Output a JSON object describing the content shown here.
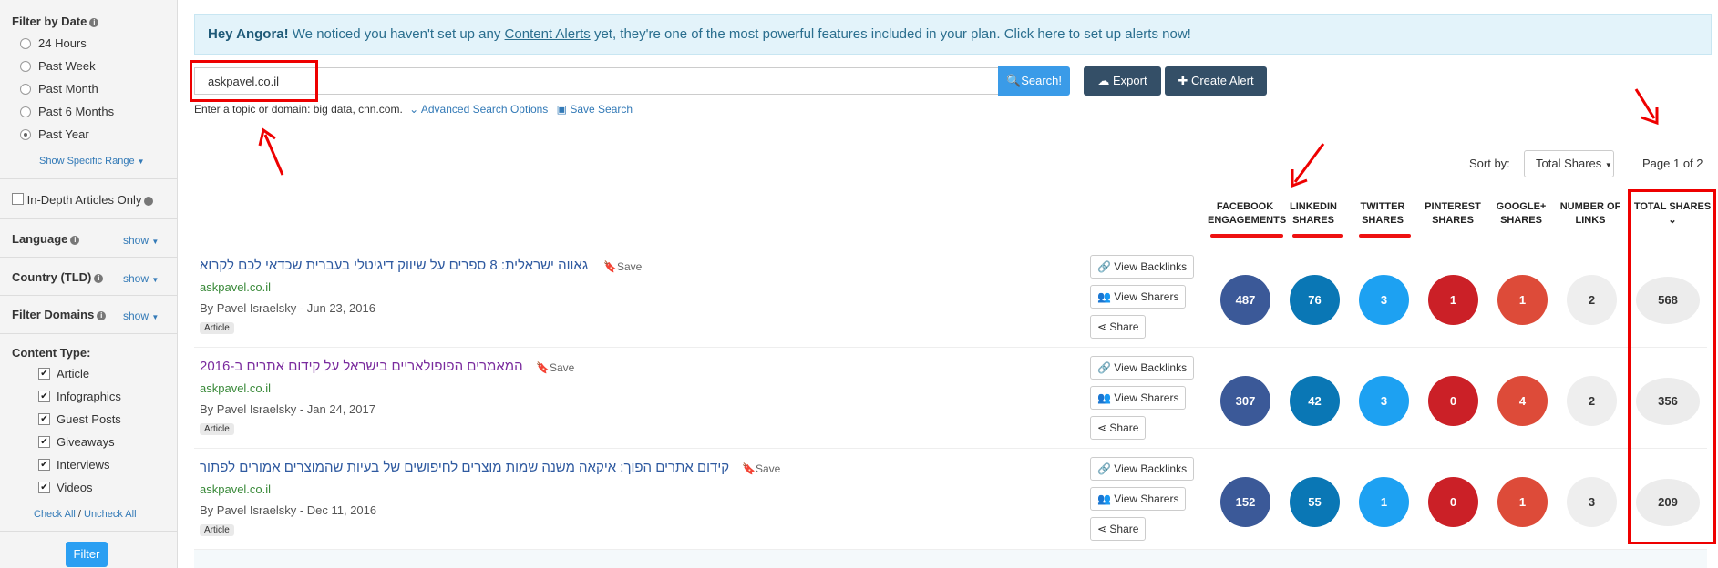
{
  "sidebar": {
    "filter_by_date": "Filter by Date",
    "date_options": [
      "24 Hours",
      "Past Week",
      "Past Month",
      "Past 6 Months",
      "Past Year"
    ],
    "selected_date": "Past Year",
    "show_specific_range": "Show Specific Range",
    "in_depth": "In-Depth Articles Only",
    "language": "Language",
    "country": "Country (TLD)",
    "filter_domains": "Filter Domains",
    "show": "show",
    "content_type": "Content Type:",
    "content_types": [
      "Article",
      "Infographics",
      "Guest Posts",
      "Giveaways",
      "Interviews",
      "Videos"
    ],
    "check_all": "Check All",
    "slash": "/",
    "uncheck_all": "Uncheck All",
    "filter_button": "Filter"
  },
  "alert": {
    "greeting": "Hey Angora!",
    "text_before": "We noticed you haven't set up any",
    "link": "Content Alerts",
    "text_after": "yet, they're one of the most powerful features included in your plan. Click here to set up alerts now!"
  },
  "search": {
    "value": "askpavel.co.il",
    "button": "Search!",
    "export": "Export",
    "create_alert": "Create Alert",
    "hint": "Enter a topic or domain: big data, cnn.com.",
    "advanced": "Advanced Search Options",
    "save_search": "Save Search"
  },
  "sort": {
    "label": "Sort by:",
    "value": "Total Shares",
    "page": "Page 1 of 2"
  },
  "columns": {
    "facebook": [
      "FACEBOOK",
      "ENGAGEMENTS"
    ],
    "linkedin": [
      "LINKEDIN",
      "SHARES"
    ],
    "twitter": [
      "TWITTER",
      "SHARES"
    ],
    "pinterest": [
      "PINTEREST",
      "SHARES"
    ],
    "google": [
      "GOOGLE+",
      "SHARES"
    ],
    "links": [
      "NUMBER OF",
      "LINKS"
    ],
    "total": "TOTAL SHARES"
  },
  "actions": {
    "view_backlinks": "View Backlinks",
    "view_sharers": "View Sharers",
    "share": "Share",
    "save": "Save"
  },
  "colors": {
    "facebook": "#3b5998",
    "linkedin": "#0a77b5",
    "twitter": "#1da1f2",
    "pinterest": "#cb2027",
    "google": "#dd4b39"
  },
  "results": [
    {
      "title": "גאווה ישראלית: 8 ספרים על שיווק דיגיטלי בעברית שכדאי לכם לקרוא",
      "domain": "askpavel.co.il",
      "by": "By Pavel Israelsky - Jun 23, 2016",
      "type": "Article",
      "facebook": "487",
      "linkedin": "76",
      "twitter": "3",
      "pinterest": "1",
      "google": "1",
      "links": "2",
      "total": "568"
    },
    {
      "title": "המאמרים הפופולאריים בישראל על קידום אתרים ב-2016",
      "domain": "askpavel.co.il",
      "by": "By Pavel Israelsky - Jan 24, 2017",
      "type": "Article",
      "facebook": "307",
      "linkedin": "42",
      "twitter": "3",
      "pinterest": "0",
      "google": "4",
      "links": "2",
      "total": "356"
    },
    {
      "title": "קידום אתרים הפוך: איקאה משנה שמות מוצרים לחיפושים של בעיות שהמוצרים אמורים לפתור",
      "domain": "askpavel.co.il",
      "by": "By Pavel Israelsky - Dec 11, 2016",
      "type": "Article",
      "facebook": "152",
      "linkedin": "55",
      "twitter": "1",
      "pinterest": "0",
      "google": "1",
      "links": "3",
      "total": "209"
    }
  ]
}
